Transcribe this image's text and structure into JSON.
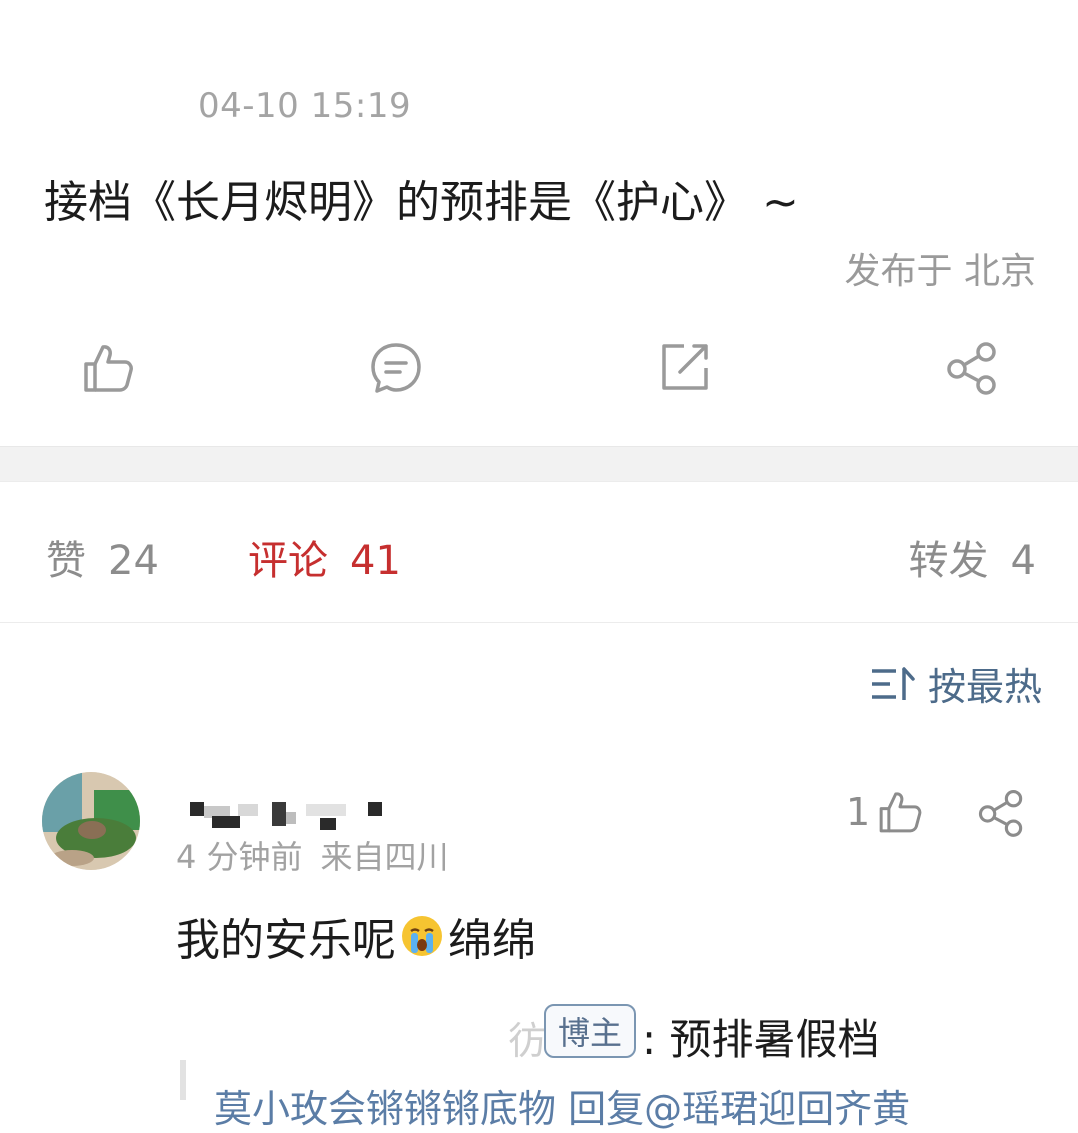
{
  "post": {
    "timestamp": "04-10 15:19",
    "text": "接档《长月烬明》的预排是《护心》 ~",
    "location": "发布于 北京"
  },
  "actions": {
    "like_icon": "thumbs-up-icon",
    "comment_icon": "comment-bubble-icon",
    "repost_icon": "repost-edit-icon",
    "share_icon": "share-icon"
  },
  "stats": {
    "likes_label": "赞",
    "likes_count": "24",
    "comments_label": "评论",
    "comments_count": "41",
    "reposts_label": "转发",
    "reposts_count": "4",
    "active_color": "#c62f2f"
  },
  "sort": {
    "label": "按最热",
    "icon": "sort-icon"
  },
  "comment": {
    "meta_time": "4 分钟前",
    "meta_location": "来自四川",
    "like_count": "1",
    "text_before_emoji": "我的安乐呢",
    "emoji": "crying-face-emoji",
    "text_after_emoji": "绵绵",
    "reply": {
      "prefix": "彷",
      "badge": "博主",
      "text": ": 预排暑假档"
    },
    "quote_preview": "莫小玫会锵锵锵底物 回复@瑶珺迎回齐黄"
  }
}
